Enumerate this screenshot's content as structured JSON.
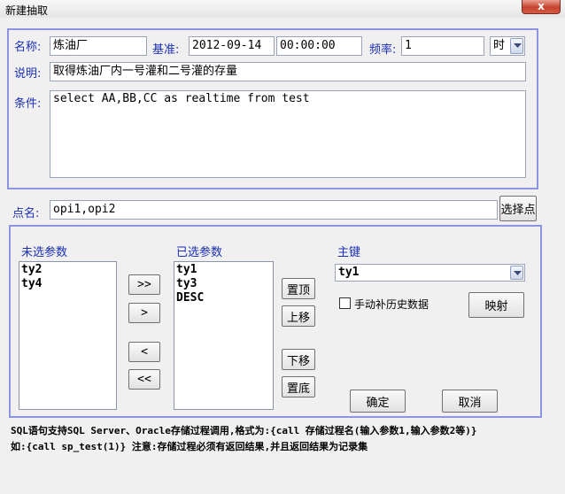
{
  "window": {
    "title": "新建抽取",
    "close_glyph": "x"
  },
  "form": {
    "name_label": "名称:",
    "name_value": "炼油厂",
    "base_label": "基准:",
    "base_date": "2012-09-14",
    "base_time": "00:00:00",
    "freq_label": "频率:",
    "freq_value": "1",
    "freq_unit": "时",
    "desc_label": "说明:",
    "desc_value": "取得炼油厂内一号灌和二号灌的存量",
    "cond_label": "条件:",
    "cond_value": "select AA,BB,CC as realtime from test",
    "points_label": "点名:",
    "points_value": "opi1,opi2",
    "select_points_button": "选择点"
  },
  "params": {
    "unselected_label": "未选参数",
    "unselected": [
      "ty2",
      "ty4"
    ],
    "selected_label": "已选参数",
    "selected": [
      "ty1",
      "ty3",
      "DESC"
    ],
    "add_all": ">>",
    "add_one": ">",
    "remove_one": "<",
    "remove_all": "<<",
    "top_button": "置顶",
    "up_button": "上移",
    "down_button": "下移",
    "bottom_button": "置底",
    "key_label": "主键",
    "key_value": "ty1",
    "backfill_label": "手动补历史数据",
    "backfill_checked": false,
    "map_button": "映射",
    "ok_button": "确定",
    "cancel_button": "取消"
  },
  "notes": {
    "line1": "SQL语句支持SQL Server、Oracle存储过程调用,格式为:{call 存储过程名(输入参数1,输入参数2等)}",
    "line2": "如:{call sp_test(1)} 注意:存储过程必须有返回结果,并且返回结果为记录集"
  }
}
